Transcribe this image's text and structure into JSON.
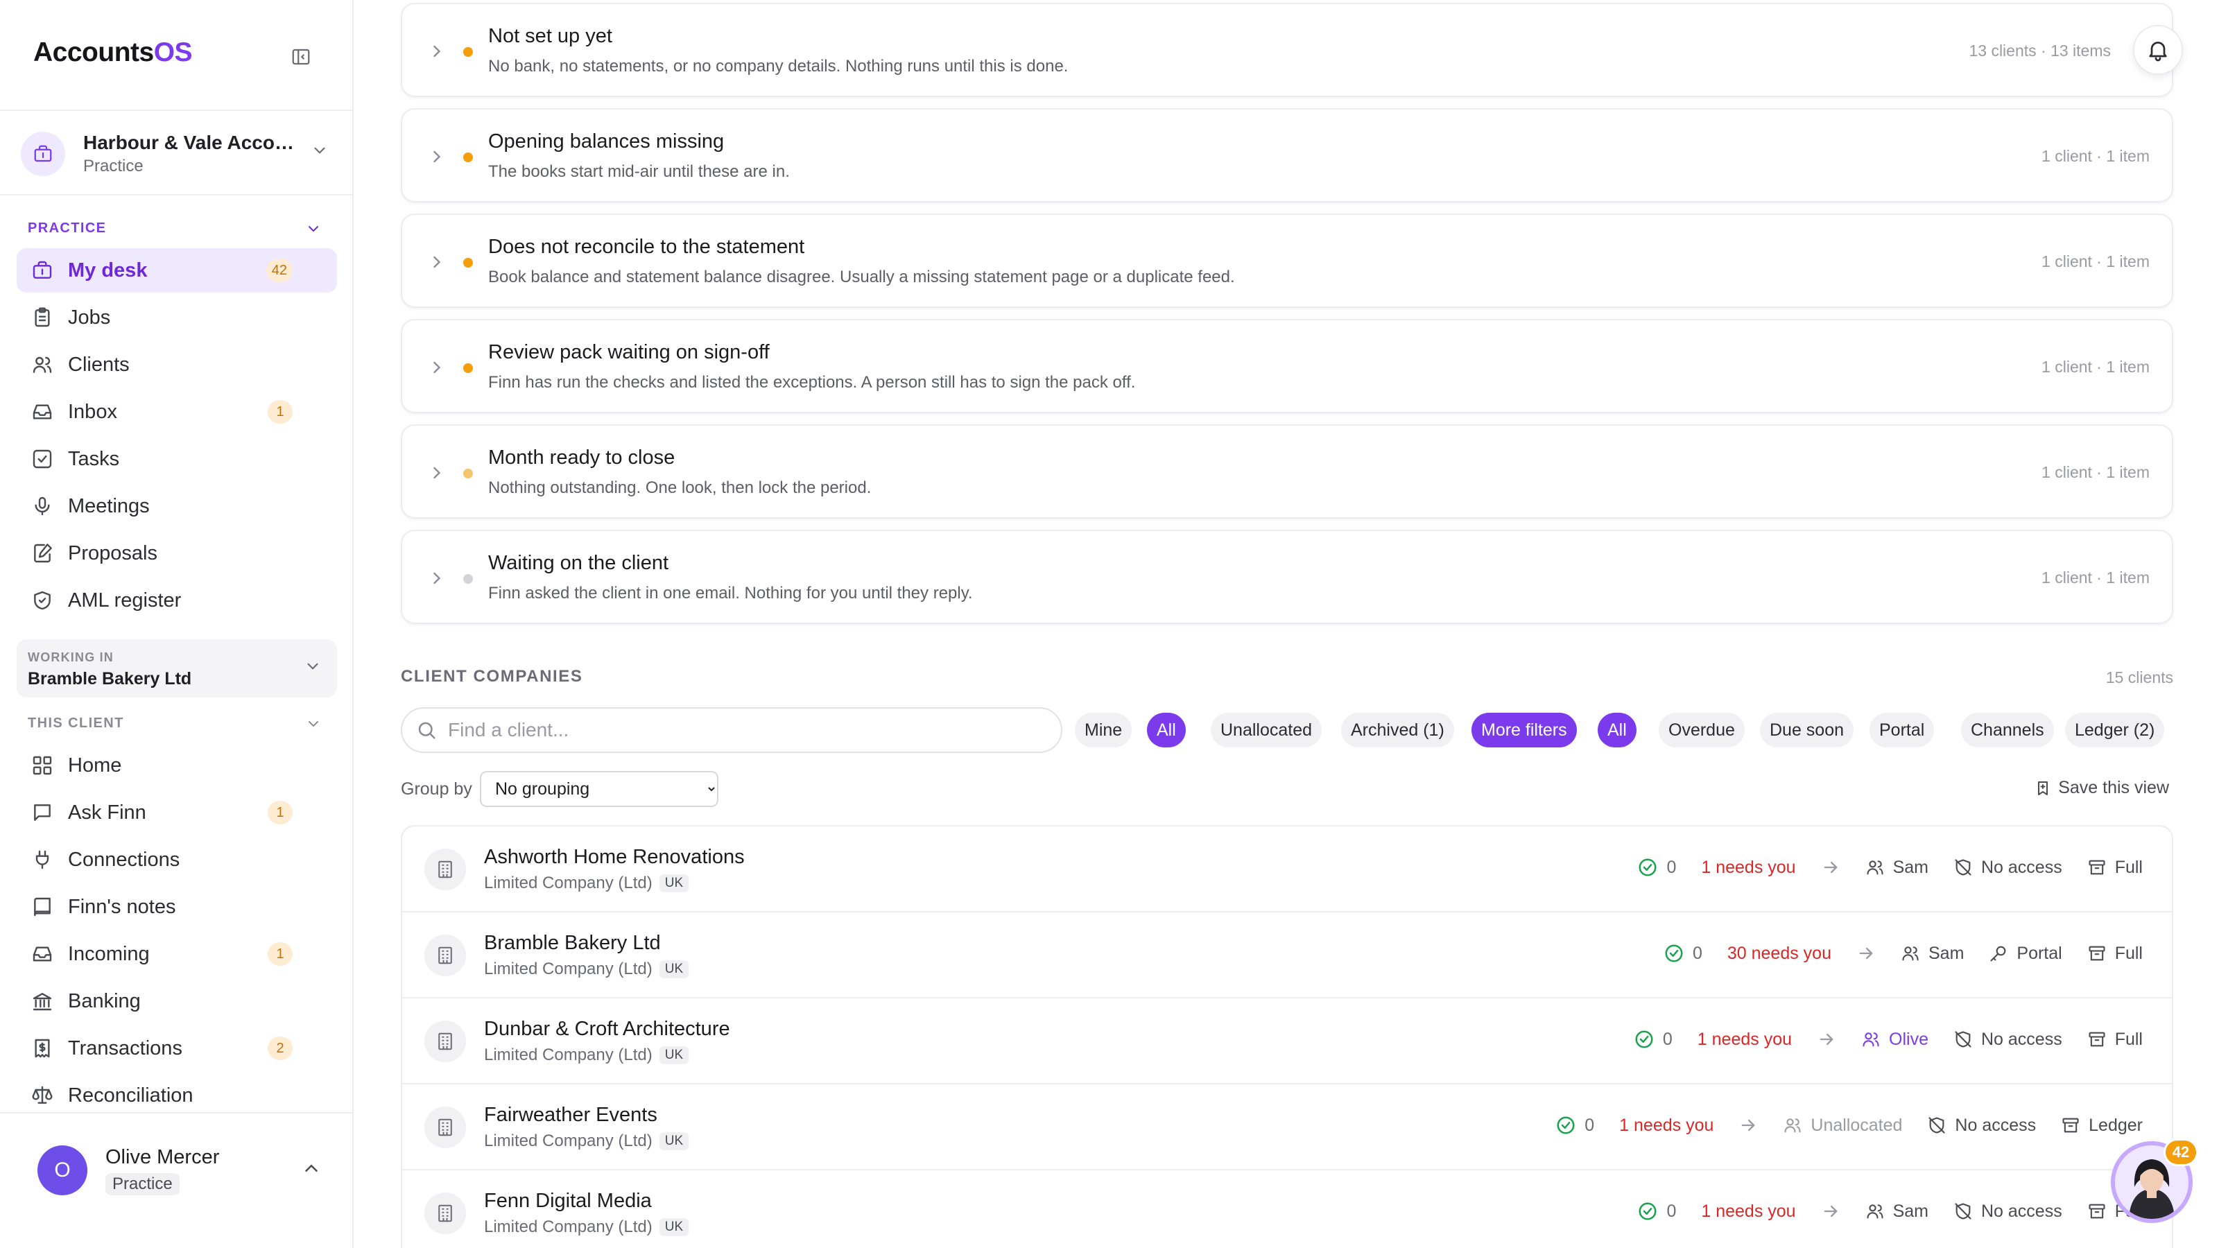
{
  "brand": {
    "name_main": "Accounts",
    "name_accent": "OS"
  },
  "org": {
    "name": "Harbour & Vale Accountants",
    "role": "Practice"
  },
  "practice_section": {
    "label": "PRACTICE",
    "items": [
      {
        "label": "My desk",
        "badge": "42",
        "icon": "briefcase-icon"
      },
      {
        "label": "Jobs",
        "badge": "",
        "icon": "clipboard-icon"
      },
      {
        "label": "Clients",
        "badge": "",
        "icon": "users-icon"
      },
      {
        "label": "Inbox",
        "badge": "1",
        "icon": "inbox-icon"
      },
      {
        "label": "Tasks",
        "badge": "",
        "icon": "checkbox-icon"
      },
      {
        "label": "Meetings",
        "badge": "",
        "icon": "microphone-icon"
      },
      {
        "label": "Proposals",
        "badge": "",
        "icon": "edit-icon"
      },
      {
        "label": "AML register",
        "badge": "",
        "icon": "shield-icon"
      }
    ]
  },
  "working_in": {
    "label": "WORKING IN",
    "value": "Bramble Bakery Ltd"
  },
  "client_section": {
    "label": "THIS CLIENT",
    "items": [
      {
        "label": "Home",
        "badge": "",
        "icon": "grid-icon"
      },
      {
        "label": "Ask Finn",
        "badge": "1",
        "icon": "chat-icon"
      },
      {
        "label": "Connections",
        "badge": "",
        "icon": "plug-icon"
      },
      {
        "label": "Finn's notes",
        "badge": "",
        "icon": "book-icon"
      },
      {
        "label": "Incoming",
        "badge": "1",
        "icon": "inbox-icon"
      },
      {
        "label": "Banking",
        "badge": "",
        "icon": "bank-icon"
      },
      {
        "label": "Transactions",
        "badge": "2",
        "icon": "receipt-icon"
      },
      {
        "label": "Reconciliation",
        "badge": "",
        "icon": "scale-icon"
      }
    ]
  },
  "user": {
    "initial": "O",
    "name": "Olive Mercer",
    "role": "Practice"
  },
  "issues": [
    {
      "title": "Not set up yet",
      "desc": "No bank, no statements, or no company details. Nothing runs until this is done.",
      "meta": "13 clients · 13 items",
      "dot": "#f59e0b"
    },
    {
      "title": "Opening balances missing",
      "desc": "The books start mid-air until these are in.",
      "meta": "1 client · 1 item",
      "dot": "#f59e0b"
    },
    {
      "title": "Does not reconcile to the statement",
      "desc": "Book balance and statement balance disagree. Usually a missing statement page or a duplicate feed.",
      "meta": "1 client · 1 item",
      "dot": "#f59e0b"
    },
    {
      "title": "Review pack waiting on sign-off",
      "desc": "Finn has run the checks and listed the exceptions. A person still has to sign the pack off.",
      "meta": "1 client · 1 item",
      "dot": "#f59e0b"
    },
    {
      "title": "Month ready to close",
      "desc": "Nothing outstanding. One look, then lock the period.",
      "meta": "1 client · 1 item",
      "dot": "#f4c56a"
    },
    {
      "title": "Waiting on the client",
      "desc": "Finn asked the client in one email. Nothing for you until they reply.",
      "meta": "1 client · 1 item",
      "dot": "#d4d4d8"
    }
  ],
  "client_companies": {
    "header": "CLIENT COMPANIES",
    "count": "15 clients",
    "search_placeholder": "Find a client...",
    "chips": [
      "Mine",
      "All",
      "Unallocated",
      "Archived (1)",
      "More filters",
      "All",
      "Overdue",
      "Due soon",
      "Portal",
      "Channels",
      "Ledger (2)"
    ],
    "group_by_label": "Group by",
    "group_by_value": "No grouping",
    "save_view": "Save this view"
  },
  "clients": [
    {
      "name": "Ashworth Home Renovations",
      "type": "Limited Company (Ltd)",
      "country": "UK",
      "ok": "0",
      "needs": "1 needs you",
      "person": "Sam",
      "access": "No access",
      "level": "Full"
    },
    {
      "name": "Bramble Bakery Ltd",
      "type": "Limited Company (Ltd)",
      "country": "UK",
      "ok": "0",
      "needs": "30 needs you",
      "person": "Sam",
      "access": "Portal",
      "level": "Full"
    },
    {
      "name": "Dunbar & Croft Architecture",
      "type": "Limited Company (Ltd)",
      "country": "UK",
      "ok": "0",
      "needs": "1 needs you",
      "person": "Olive",
      "access": "No access",
      "level": "Full"
    },
    {
      "name": "Fairweather Events",
      "type": "Limited Company (Ltd)",
      "country": "UK",
      "ok": "0",
      "needs": "1 needs you",
      "person": "Unallocated",
      "access": "No access",
      "level": "Ledger"
    },
    {
      "name": "Fenn Digital Media",
      "type": "Limited Company (Ltd)",
      "country": "UK",
      "ok": "0",
      "needs": "1 needs you",
      "person": "Sam",
      "access": "No access",
      "level": "Full"
    }
  ],
  "assistant_badge": "42"
}
